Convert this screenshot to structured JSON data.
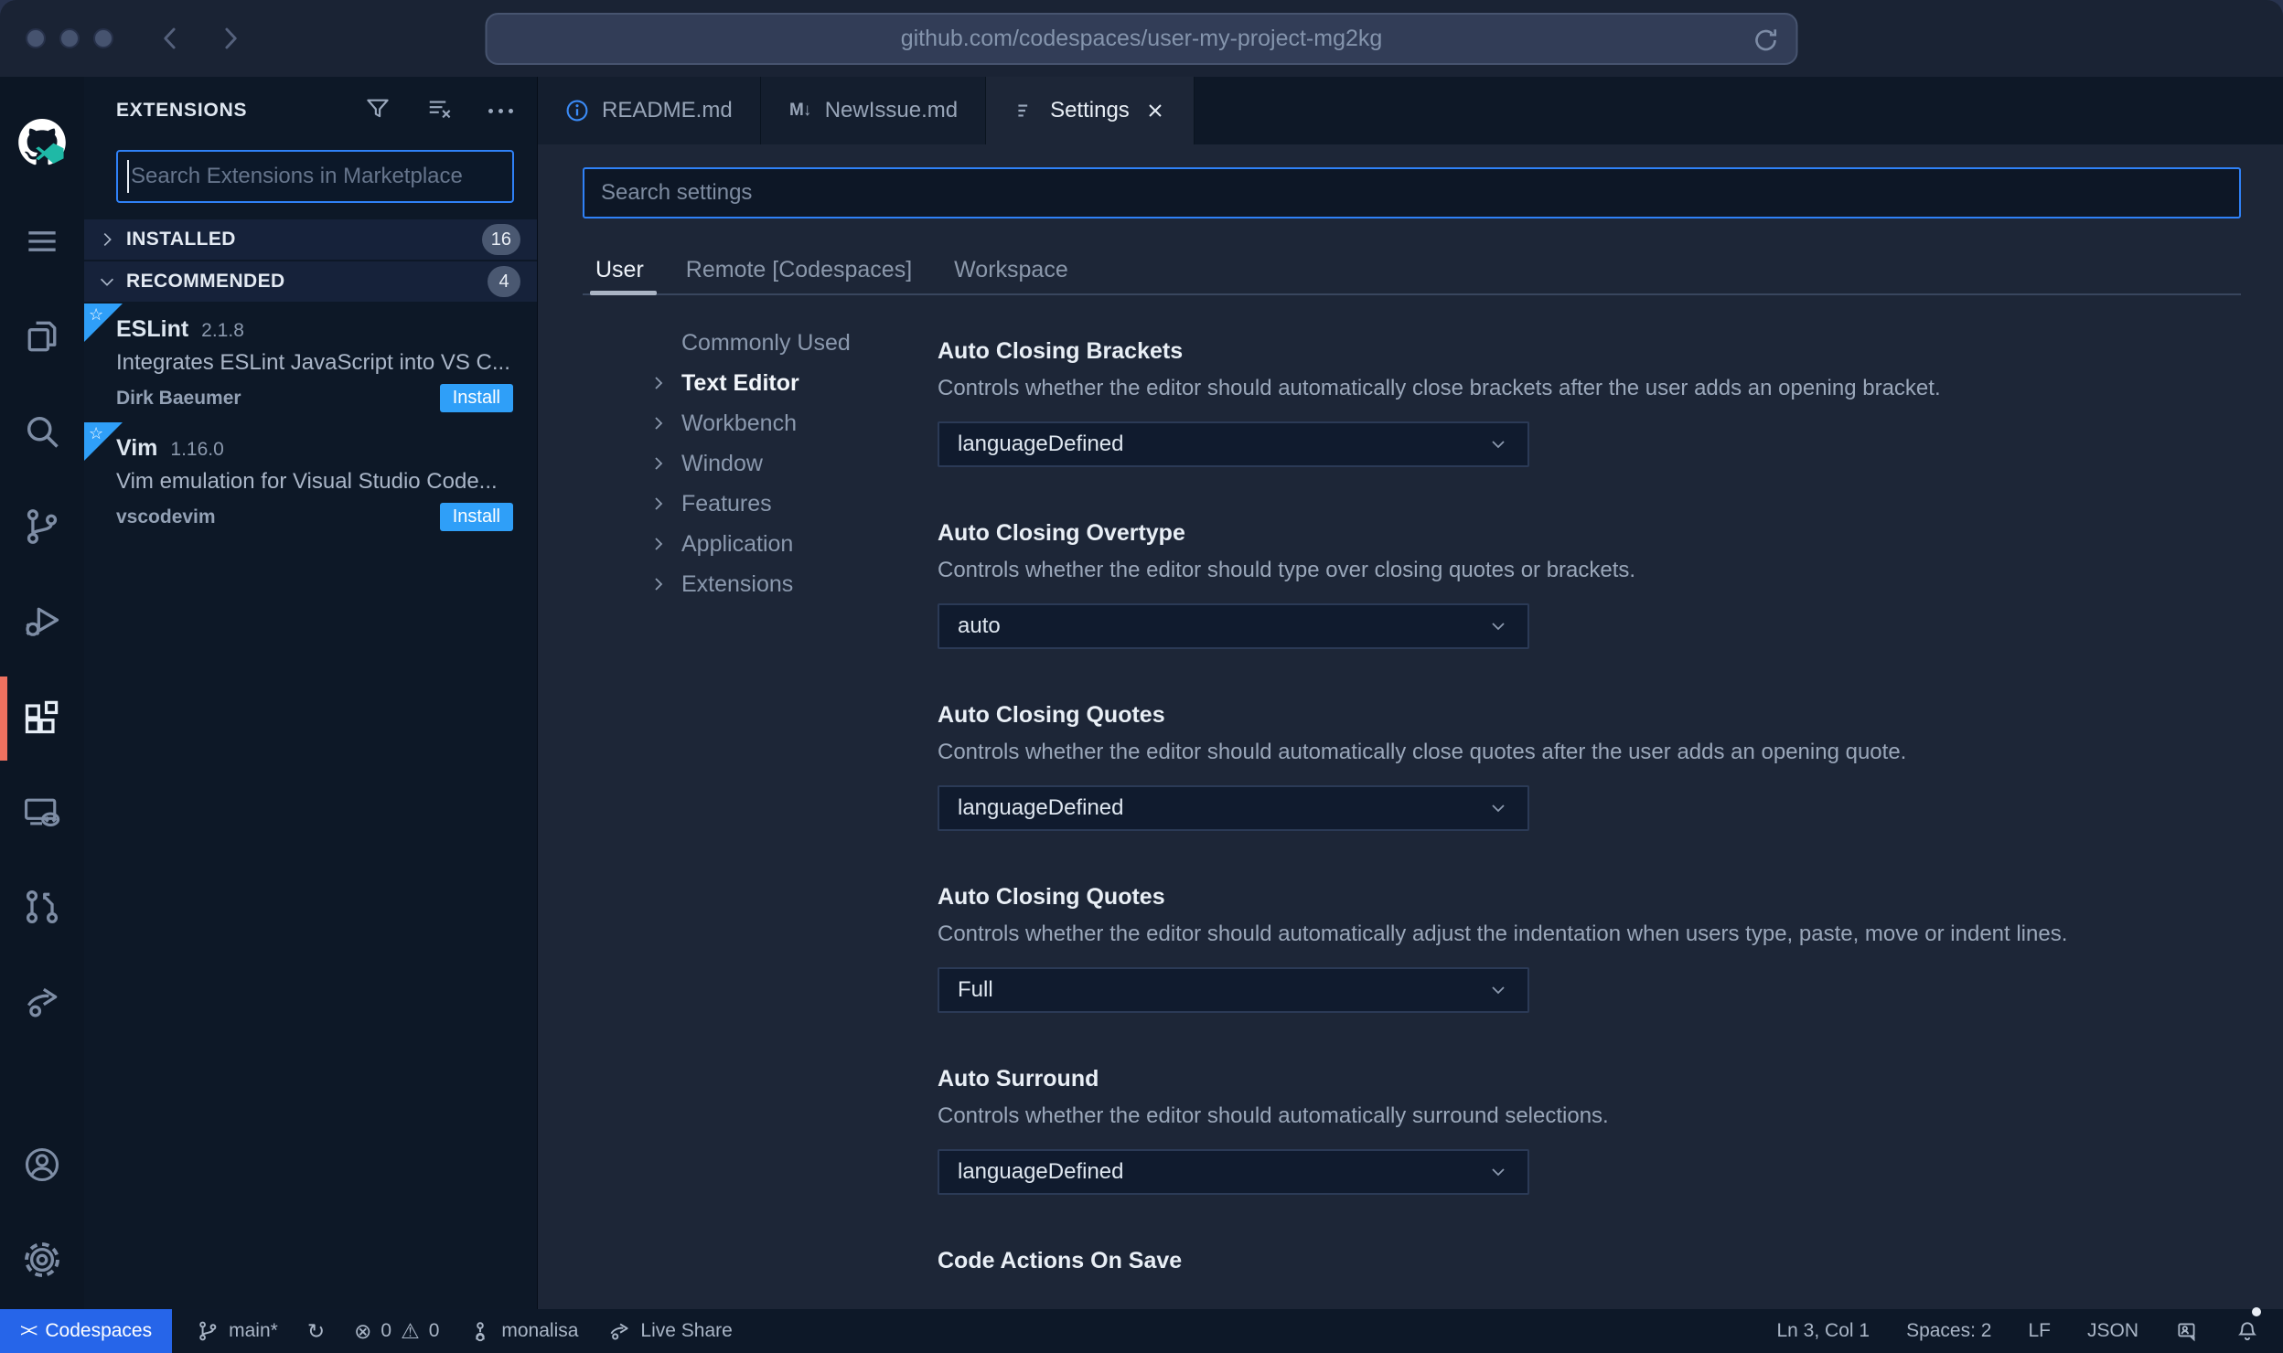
{
  "browser": {
    "url": "github.com/codespaces/user-my-project-mg2kg"
  },
  "icons": {
    "star": "☆",
    "markdown": "M↓",
    "remote": "><",
    "sync": "↻",
    "error": "⊗",
    "warning": "⚠"
  },
  "colors": {
    "accent": "#2f81f7",
    "install_button": "#2f9ff8",
    "codespaces_segment": "#2665e9",
    "active_indicator": "#ee7160",
    "editor_bg": "#1d2637",
    "sidebar_bg": "#0d1827"
  },
  "extensions_panel": {
    "title": "EXTENSIONS",
    "search_placeholder": "Search Extensions in Marketplace",
    "sections": [
      {
        "label": "INSTALLED",
        "count": "16"
      },
      {
        "label": "RECOMMENDED",
        "count": "4"
      }
    ],
    "items": [
      {
        "name": "ESLint",
        "version": "2.1.8",
        "description": "Integrates ESLint JavaScript into VS C...",
        "publisher": "Dirk Baeumer",
        "action": "Install"
      },
      {
        "name": "Vim",
        "version": "1.16.0",
        "description": "Vim emulation for Visual Studio Code...",
        "publisher": "vscodevim",
        "action": "Install"
      }
    ]
  },
  "tabs": [
    {
      "label": "README.md"
    },
    {
      "label": "NewIssue.md"
    },
    {
      "label": "Settings"
    }
  ],
  "settings": {
    "search_placeholder": "Search settings",
    "scopes": [
      {
        "label": "User"
      },
      {
        "label": "Remote [Codespaces]"
      },
      {
        "label": "Workspace"
      }
    ],
    "tree": [
      {
        "label": "Commonly Used"
      },
      {
        "label": "Text Editor"
      },
      {
        "label": "Workbench"
      },
      {
        "label": "Window"
      },
      {
        "label": "Features"
      },
      {
        "label": "Application"
      },
      {
        "label": "Extensions"
      }
    ],
    "items": [
      {
        "title": "Auto Closing Brackets",
        "description": "Controls whether the editor should automatically close brackets after the user adds an opening bracket.",
        "value": "languageDefined"
      },
      {
        "title": "Auto Closing Overtype",
        "description": "Controls whether the editor should type over closing quotes or brackets.",
        "value": "auto"
      },
      {
        "title": "Auto Closing Quotes",
        "description": "Controls whether the editor should automatically close quotes after the user adds an opening quote.",
        "value": "languageDefined"
      },
      {
        "title": "Auto Closing Quotes",
        "description": "Controls whether the editor should automatically adjust the indentation when users type, paste, move or indent lines.",
        "value": "Full"
      },
      {
        "title": "Auto Surround",
        "description": "Controls whether the editor should automatically surround selections.",
        "value": "languageDefined"
      },
      {
        "title": "Code Actions On Save"
      }
    ]
  },
  "status_bar": {
    "codespaces": "Codespaces",
    "branch": "main*",
    "errors": "0",
    "warnings": "0",
    "user": "monalisa",
    "live_share": "Live Share",
    "line_col": "Ln 3, Col 1",
    "indent": "Spaces: 2",
    "eol": "LF",
    "language": "JSON"
  }
}
